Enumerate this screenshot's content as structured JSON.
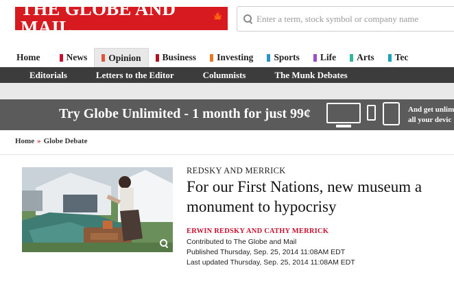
{
  "masthead": {
    "logo_text": "THE GLOBE AND MAIL",
    "logo_leaf": "🍁",
    "search_placeholder": "Enter a term, stock symbol or company name"
  },
  "nav": {
    "items": [
      {
        "label": "Home",
        "color": ""
      },
      {
        "label": "News",
        "color": "#c8102e"
      },
      {
        "label": "Opinion",
        "color": "#e2533b",
        "active": true
      },
      {
        "label": "Business",
        "color": "#b1121b"
      },
      {
        "label": "Investing",
        "color": "#e67a22"
      },
      {
        "label": "Sports",
        "color": "#2a91c9"
      },
      {
        "label": "Life",
        "color": "#9b4dca"
      },
      {
        "label": "Arts",
        "color": "#2fb59a"
      },
      {
        "label": "Tec",
        "color": "#1ca3b8"
      }
    ]
  },
  "subnav": {
    "items": [
      "Editorials",
      "Letters to the Editor",
      "Columnists",
      "The Munk Debates"
    ]
  },
  "promo": {
    "text": "Try Globe Unlimited - 1 month for just 99¢",
    "side_line1": "And get unlim",
    "side_line2": "all your devic"
  },
  "breadcrumb": {
    "home": "Home",
    "separator": "»",
    "current": "Globe Debate"
  },
  "article": {
    "kicker": "REDSKY AND MERRICK",
    "headline": "For our First Nations, new museum a monument to hypocrisy",
    "byline": "ERWIN REDSKY AND CATHY MERRICK",
    "contributed": "Contributed to The Globe and Mail",
    "published": "Published Thursday, Sep. 25, 2014 11:08AM EDT",
    "updated": "Last updated Thursday, Sep. 25, 2014 11:08AM EDT"
  },
  "colors": {
    "brand_red": "#d71920",
    "subnav_bg": "#3c3c3c",
    "promo_bg": "#5b5b5b"
  }
}
